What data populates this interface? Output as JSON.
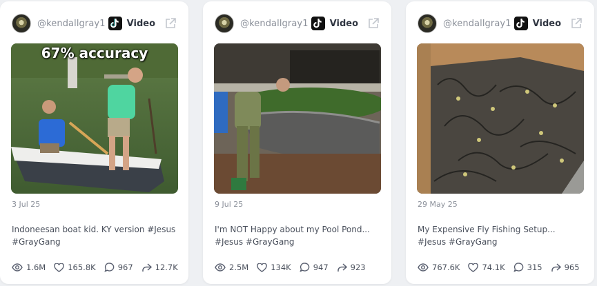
{
  "cards": [
    {
      "handle": "@kendallgray1",
      "platform_label": "Video",
      "overlay_text": "67% accuracy",
      "date": "3 Jul 25",
      "caption": "Indoneesan boat kid. KY version #Jesus #GrayGang",
      "views": "1.6M",
      "likes": "165.8K",
      "comments": "967",
      "shares": "12.7K"
    },
    {
      "handle": "@kendallgray1",
      "platform_label": "Video",
      "date": "9 Jul 25",
      "caption": "I'm NOT Happy about my Pool Pond... #Jesus #GrayGang",
      "views": "2.5M",
      "likes": "134K",
      "comments": "947",
      "shares": "923"
    },
    {
      "handle": "@kendallgray1",
      "platform_label": "Video",
      "date": "29 May 25",
      "caption": "My Expensive Fly Fishing Setup... #Jesus #GrayGang",
      "views": "767.6K",
      "likes": "74.1K",
      "comments": "315",
      "shares": "965"
    }
  ]
}
